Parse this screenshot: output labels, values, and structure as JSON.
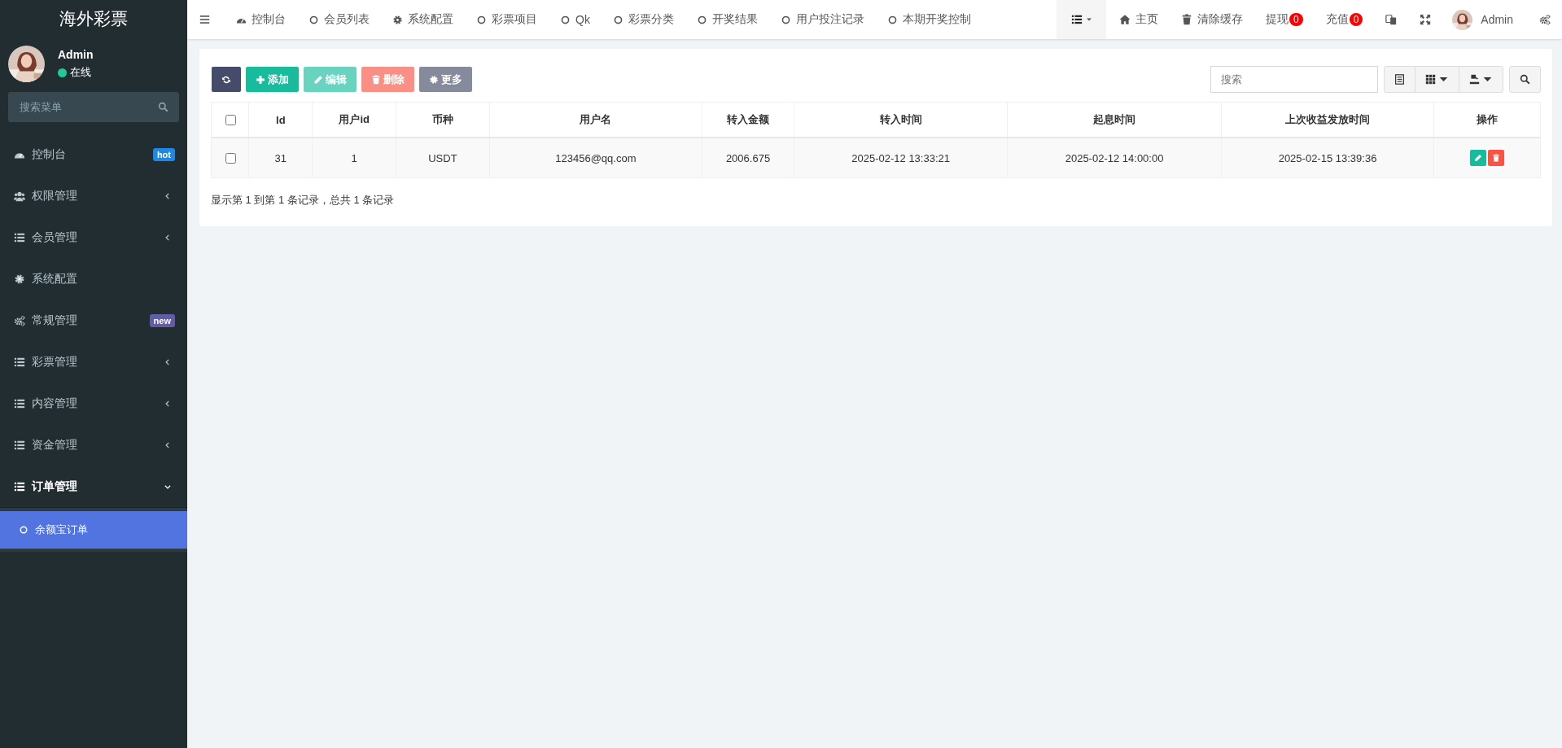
{
  "sidebar": {
    "logo": "海外彩票",
    "user": {
      "name": "Admin",
      "status": "在线",
      "online": true
    },
    "search": {
      "placeholder": "搜索菜单"
    },
    "items": [
      {
        "label": "控制台",
        "kind": "gauge",
        "selected": false,
        "badge": {
          "text": "hot",
          "color": "#1e88e5"
        }
      },
      {
        "label": "权限管理",
        "kind": "users",
        "selected": false,
        "expanded": false
      },
      {
        "label": "会员管理",
        "kind": "list",
        "selected": false,
        "expanded": false
      },
      {
        "label": "系统配置",
        "kind": "gear",
        "selected": false
      },
      {
        "label": "常规管理",
        "kind": "gears",
        "selected": false,
        "badge": {
          "text": "new",
          "color": "#605ca8"
        }
      },
      {
        "label": "彩票管理",
        "kind": "list",
        "selected": false,
        "expanded": false
      },
      {
        "label": "内容管理",
        "kind": "list",
        "selected": false,
        "expanded": false
      },
      {
        "label": "资金管理",
        "kind": "list",
        "selected": false,
        "expanded": false
      },
      {
        "label": "订单管理",
        "kind": "list",
        "selected": false,
        "expanded": true,
        "children": [
          {
            "label": "余额宝订单",
            "kind": "circle",
            "selected": true
          }
        ]
      }
    ]
  },
  "top_nav": {
    "tabs": [
      {
        "label": "控制台",
        "kind": "gauge"
      },
      {
        "label": "会员列表",
        "kind": "circle"
      },
      {
        "label": "系统配置",
        "kind": "gear"
      },
      {
        "label": "彩票项目",
        "kind": "circle"
      },
      {
        "label": "Qk",
        "kind": "circle"
      },
      {
        "label": "彩票分类",
        "kind": "circle"
      },
      {
        "label": "开奖结果",
        "kind": "circle"
      },
      {
        "label": "用户投注记录",
        "kind": "circle"
      },
      {
        "label": "本期开奖控制",
        "kind": "circle"
      }
    ],
    "right": [
      {
        "label": "主页",
        "kind": "home"
      },
      {
        "label": "清除缓存",
        "kind": "trash"
      },
      {
        "label": "提现",
        "kind": "count",
        "count": "0"
      },
      {
        "label": "充值",
        "kind": "count",
        "count": "0"
      },
      {
        "kind": "translate"
      },
      {
        "kind": "fullscreen"
      },
      {
        "label": "Admin",
        "kind": "user"
      },
      {
        "kind": "gears"
      }
    ]
  },
  "toolbar": {
    "buttons": [
      {
        "kind": "refresh",
        "disabled": false
      },
      {
        "label": "添加",
        "kind": "plus",
        "disabled": false
      },
      {
        "label": "编辑",
        "kind": "pencil",
        "disabled": true
      },
      {
        "label": "删除",
        "kind": "trash",
        "disabled": true
      },
      {
        "label": "更多",
        "kind": "gear",
        "disabled": true
      }
    ],
    "search": {
      "placeholder": "搜索"
    }
  },
  "table": {
    "columns": [
      "Id",
      "用户id",
      "币种",
      "用户名",
      "转入金额",
      "转入时间",
      "起息时间",
      "上次收益发放时间",
      "操作"
    ],
    "all_checked": false,
    "rows": [
      {
        "checked": false,
        "cells": [
          "31",
          "1",
          "USDT",
          "123456@qq.com",
          "2006.675",
          "2025-02-12 13:33:21",
          "2025-02-12 14:00:00",
          "2025-02-15 13:39:36"
        ]
      }
    ]
  },
  "pagination_info": "显示第 1 到第 1 条记录，总共 1 条记录"
}
